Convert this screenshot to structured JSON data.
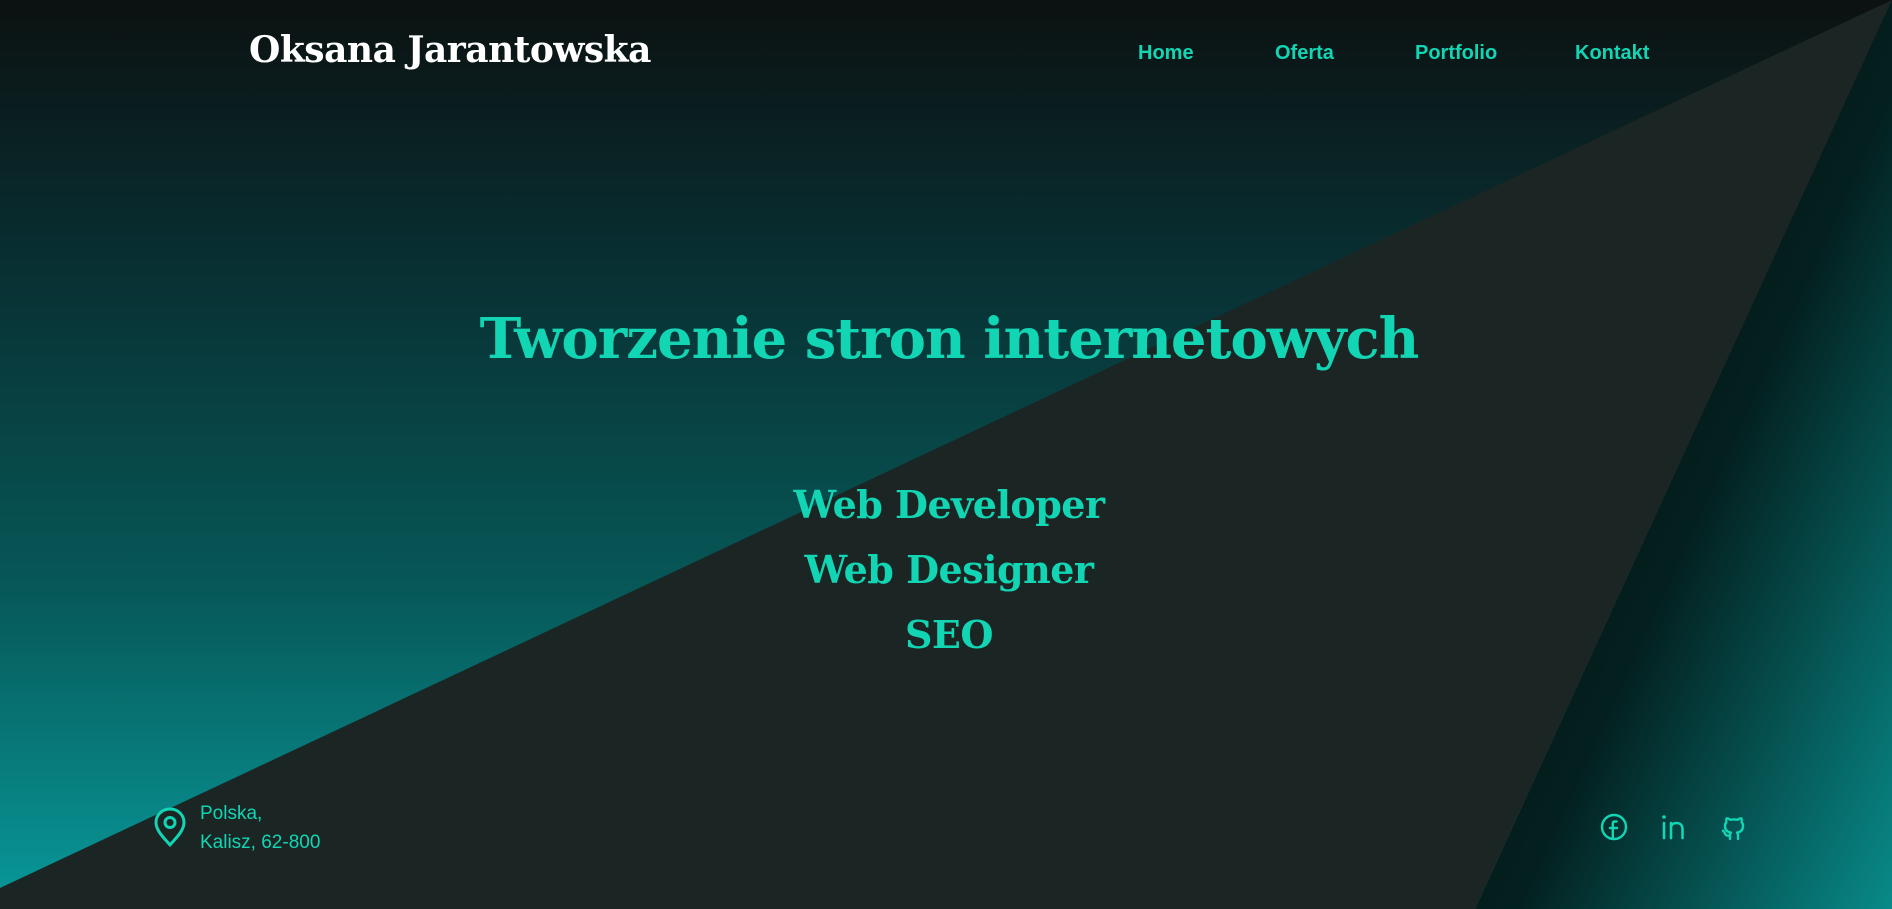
{
  "header": {
    "brand": "Oksana Jarantowska",
    "nav": [
      {
        "label": "Home"
      },
      {
        "label": "Oferta"
      },
      {
        "label": "Portfolio"
      },
      {
        "label": "Kontakt"
      }
    ]
  },
  "hero": {
    "title": "Tworzenie stron internetowych",
    "roles": [
      "Web Developer",
      "Web Designer",
      "SEO"
    ]
  },
  "footer": {
    "location": {
      "icon": "map-pin-icon",
      "line1": "Polska,",
      "line2": "Kalisz, 62-800"
    },
    "social": [
      {
        "icon": "facebook-icon"
      },
      {
        "icon": "linkedin-icon"
      },
      {
        "icon": "github-icon"
      }
    ]
  },
  "colors": {
    "accent": "#12d5b4",
    "dark_panel": "#1b2624",
    "background_top": "#0c1111",
    "teal_bottom": "#06898a",
    "brand_text": "#ffffff"
  }
}
